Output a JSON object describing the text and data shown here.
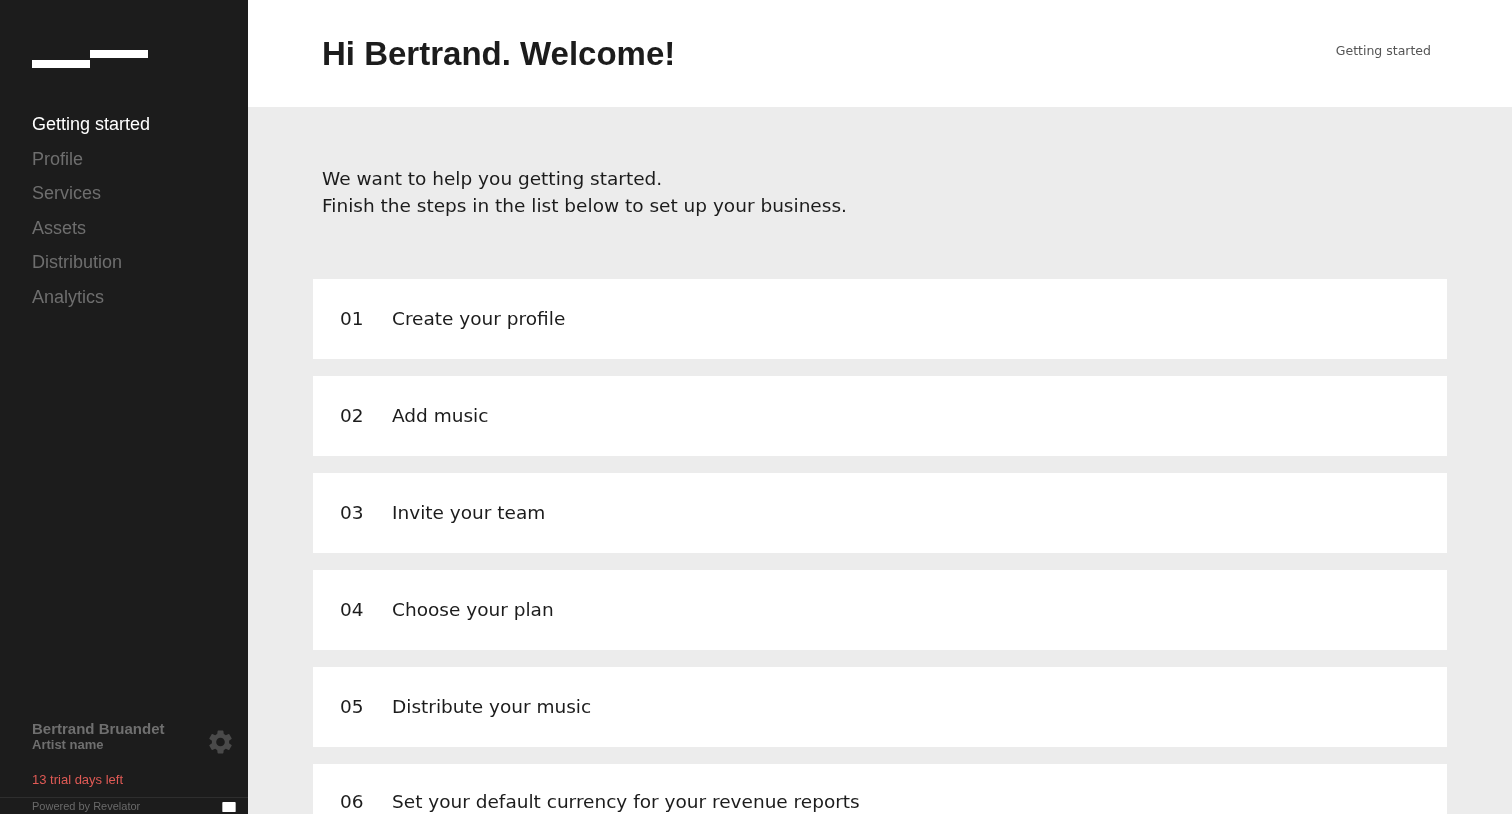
{
  "sidebar": {
    "nav_items": [
      {
        "label": "Getting started",
        "selected": true
      },
      {
        "label": "Profile",
        "selected": false
      },
      {
        "label": "Services",
        "selected": false
      },
      {
        "label": "Assets",
        "selected": false
      },
      {
        "label": "Distribution",
        "selected": false
      },
      {
        "label": "Analytics",
        "selected": false
      }
    ],
    "user": {
      "name": "Bertrand Bruandet",
      "role": "Artist name"
    },
    "trial_notice": "13 trial days left",
    "footer": "Powered by Revelator"
  },
  "header": {
    "title": "Hi Bertrand. Welcome!",
    "breadcrumb": "Getting started"
  },
  "intro": [
    "We want to help you getting started.",
    "Finish the steps in the list below to set up your business."
  ],
  "steps": [
    {
      "number": "01",
      "label": "Create your profile"
    },
    {
      "number": "02",
      "label": "Add music"
    },
    {
      "number": "03",
      "label": "Invite your team"
    },
    {
      "number": "04",
      "label": "Choose your plan"
    },
    {
      "number": "05",
      "label": "Distribute your music"
    },
    {
      "number": "06",
      "label": "Set your default currency for your revenue reports"
    }
  ]
}
